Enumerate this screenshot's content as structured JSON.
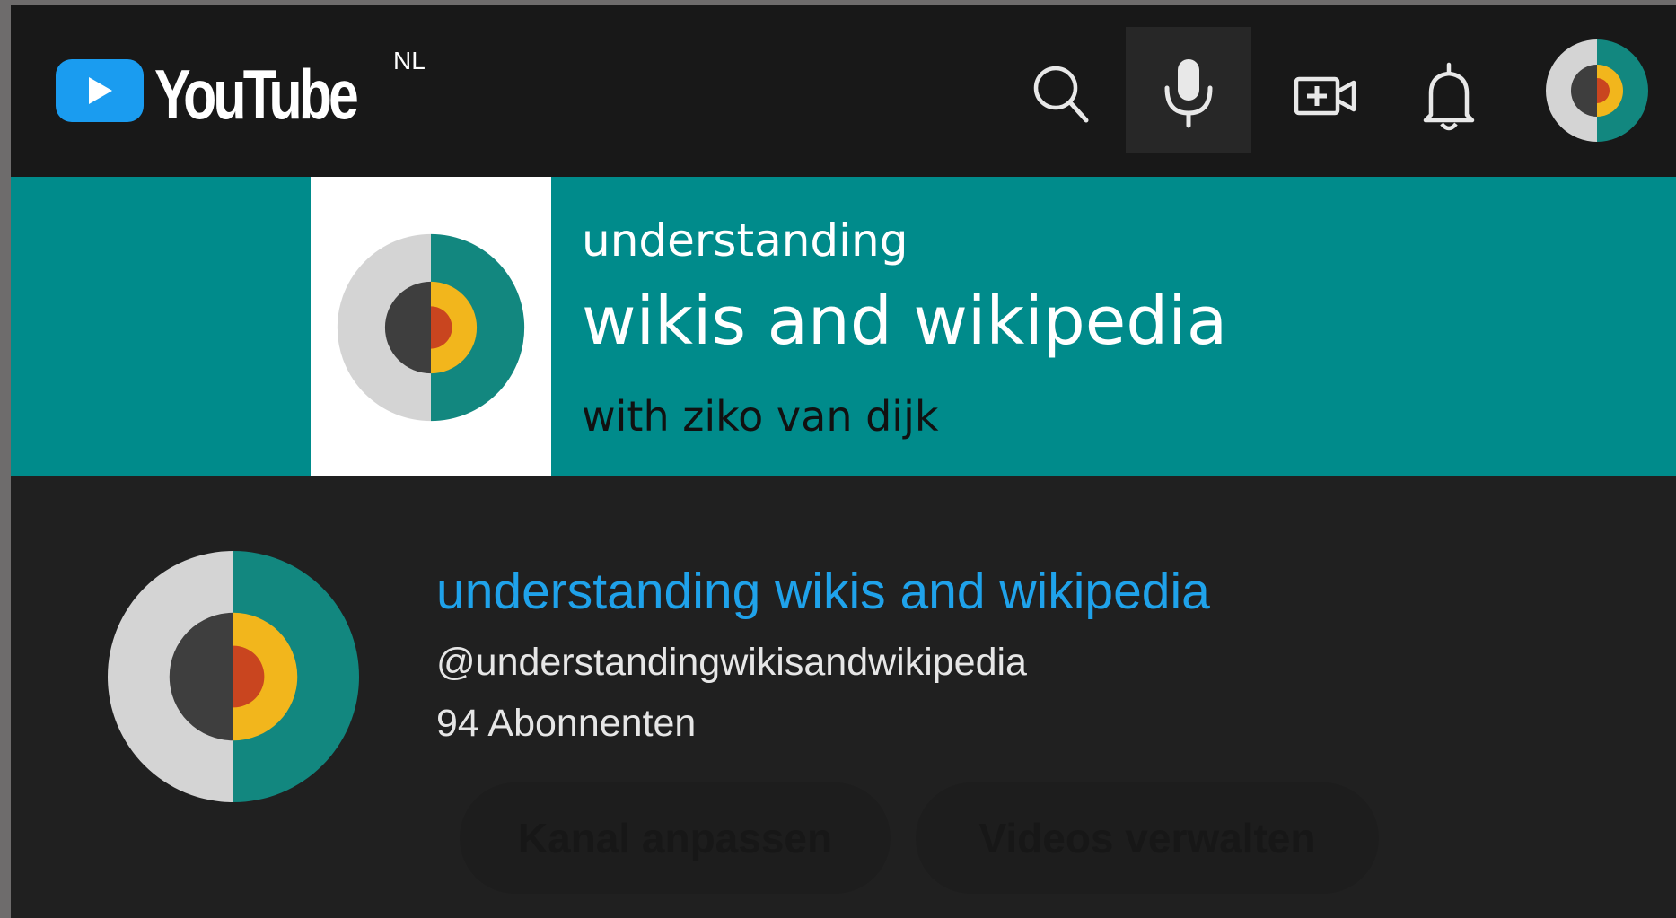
{
  "header": {
    "logo_text": "YouTube",
    "country_code": "NL",
    "icons": [
      "search-icon",
      "microphone-icon",
      "create-video-icon",
      "notifications-bell-icon",
      "account-avatar"
    ]
  },
  "banner": {
    "line1": "understanding",
    "line2": "wikis and wikipedia",
    "line3": "with ziko van dijk",
    "background_color": "#008b8b"
  },
  "channel": {
    "name": "understanding wikis and wikipedia",
    "handle": "@understandingwikisandwikipedia",
    "subscribers": "94 Abonnenten",
    "name_color": "#1fa2ea"
  },
  "actions": {
    "customize_label": "Kanal anpassen",
    "manage_label": "Videos verwalten"
  },
  "colors": {
    "topbar": "#181818",
    "page": "#202020",
    "brand_teal": "#12877f",
    "logo_grey": "#d4d4d4",
    "logo_dark": "#3e3e3e",
    "logo_yellow": "#f2b61c",
    "logo_red": "#c9451f"
  }
}
